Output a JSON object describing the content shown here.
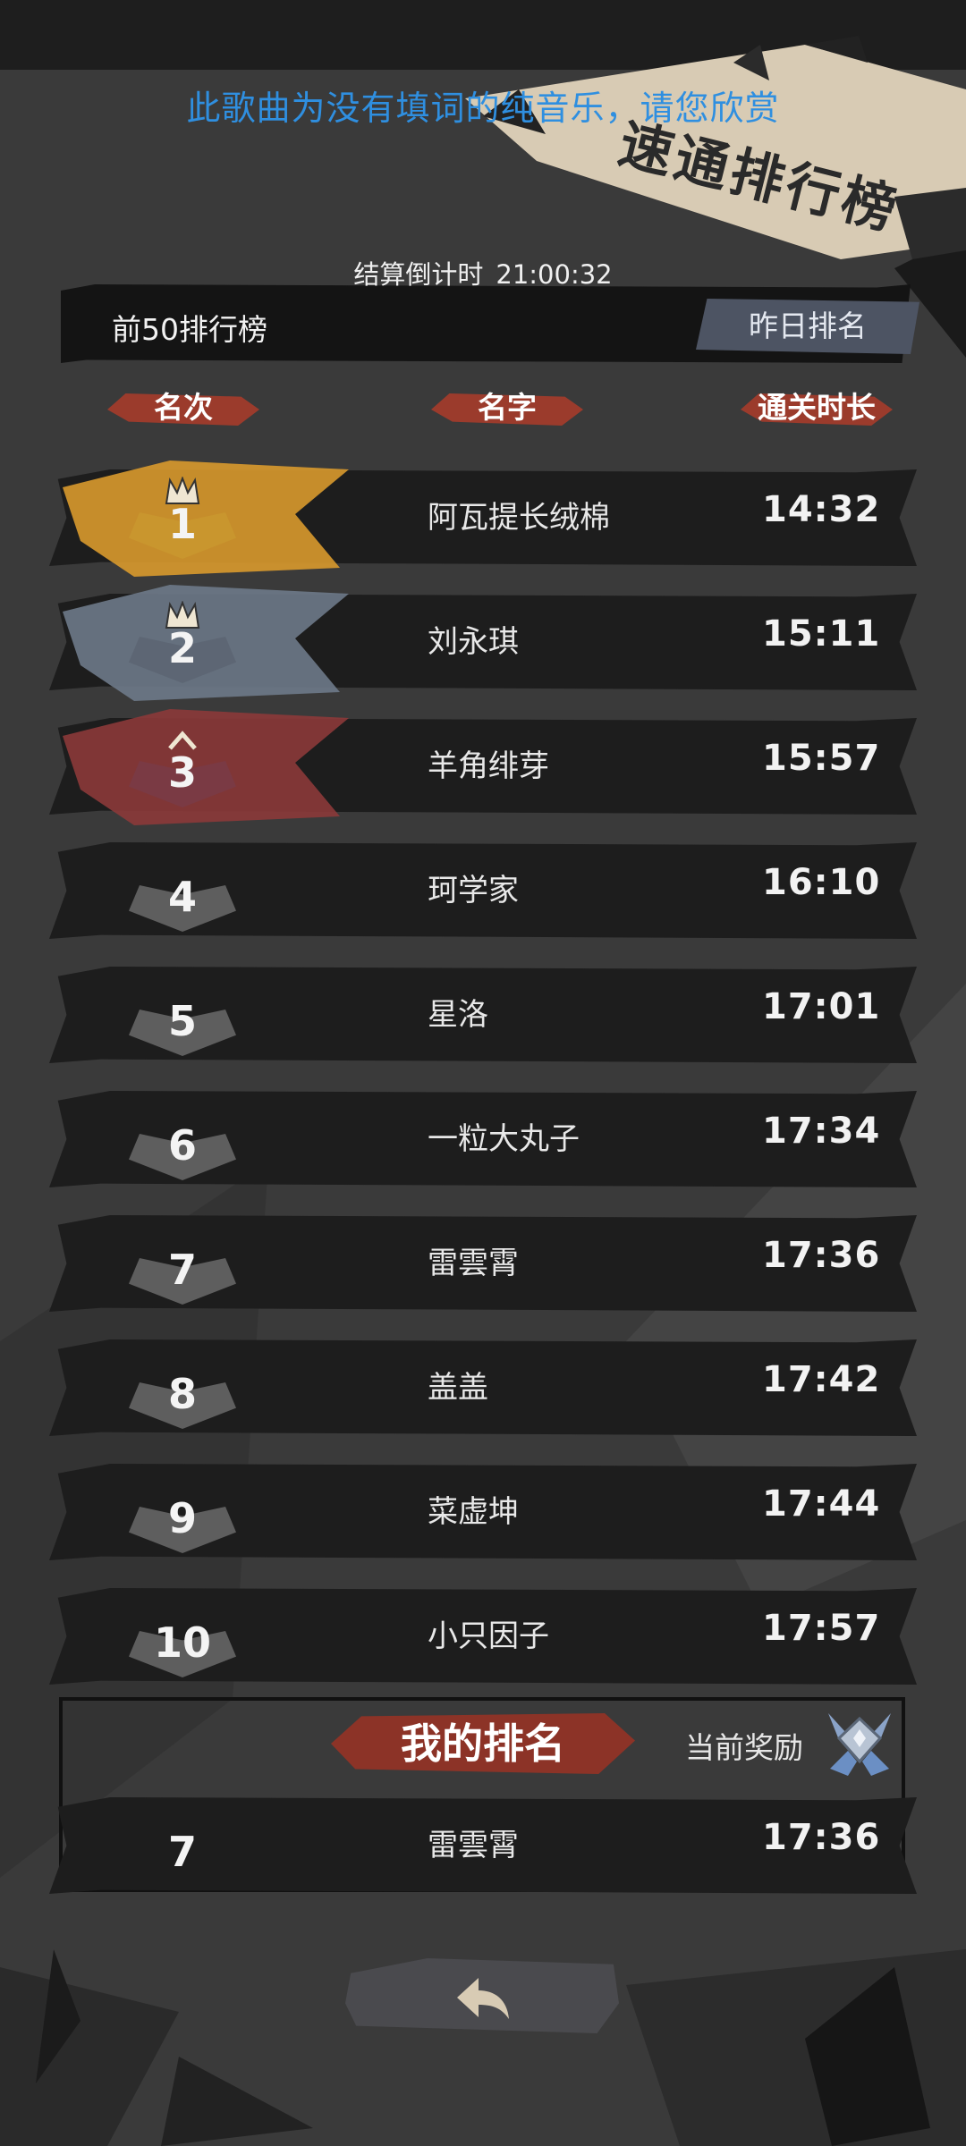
{
  "notice": "此歌曲为没有填词的纯音乐，请您欣赏",
  "page_title": "速通排行榜",
  "countdown": {
    "label": "结算倒计时",
    "time": "21:00:32"
  },
  "board": {
    "title": "前50排行榜",
    "yesterday_label": "昨日排名"
  },
  "columns": {
    "rank": "名次",
    "name": "名字",
    "time": "通关时长"
  },
  "rows": [
    {
      "rank": "1",
      "name": "阿瓦提长绒棉",
      "time": "14:32"
    },
    {
      "rank": "2",
      "name": "刘永琪",
      "time": "15:11"
    },
    {
      "rank": "3",
      "name": "羊角绯芽",
      "time": "15:57"
    },
    {
      "rank": "4",
      "name": "珂学家",
      "time": "16:10"
    },
    {
      "rank": "5",
      "name": "星洛",
      "time": "17:01"
    },
    {
      "rank": "6",
      "name": "一粒大丸子",
      "time": "17:34"
    },
    {
      "rank": "7",
      "name": "雷雲霄",
      "time": "17:36"
    },
    {
      "rank": "8",
      "name": "盖盖",
      "time": "17:42"
    },
    {
      "rank": "9",
      "name": "菜虚坤",
      "time": "17:44"
    },
    {
      "rank": "10",
      "name": "小只因子",
      "time": "17:57"
    }
  ],
  "my_rank": {
    "title": "我的排名",
    "reward_label": "当前奖励",
    "reward_icon": "silver-medal-icon",
    "row": {
      "rank": "7",
      "name": "雷雲霄",
      "time": "17:36"
    }
  },
  "back_icon": "back-arrow-icon",
  "colors": {
    "gold": "#d99a2e",
    "silver": "#6e7a8a",
    "bronze": "#8c3a3a",
    "default_badge": "#5e5e5e",
    "notice_blue": "#2f8fe0",
    "accent_red": "#9b3b2c"
  }
}
